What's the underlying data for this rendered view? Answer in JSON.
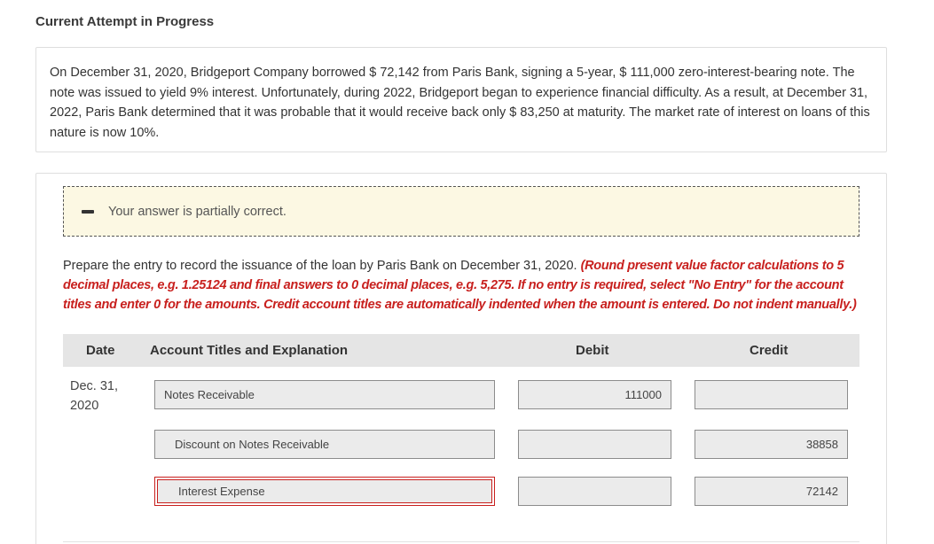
{
  "header": {
    "section_title": "Current Attempt in Progress"
  },
  "question": {
    "text": "On December 31, 2020, Bridgeport Company borrowed $ 72,142 from Paris Bank, signing a 5-year, $ 111,000 zero-interest-bearing note. The note was issued to yield 9% interest. Unfortunately, during 2022, Bridgeport began to experience financial difficulty. As a result, at December 31, 2022, Paris Bank determined that it was probable that it would receive back only $ 83,250 at maturity. The market rate of interest on loans of this nature is now 10%."
  },
  "feedback": {
    "text": "Your answer is partially correct."
  },
  "instructions": {
    "prompt": "Prepare the entry to record the issuance of the loan by Paris Bank on December 31, 2020.",
    "note": "(Round present value factor calculations to 5 decimal places, e.g. 1.25124 and final answers to 0 decimal places, e.g. 5,275. If no entry is required, select \"No Entry\" for the account titles and enter 0 for the amounts. Credit account titles are automatically indented when the amount is entered. Do not indent manually.)"
  },
  "table": {
    "headers": {
      "date": "Date",
      "account": "Account Titles and Explanation",
      "debit": "Debit",
      "credit": "Credit"
    },
    "date_line1": "Dec. 31,",
    "date_line2": "2020",
    "rows": [
      {
        "account": "Notes Receivable",
        "debit": "111000",
        "credit": ""
      },
      {
        "account": "Discount on Notes Receivable",
        "debit": "",
        "credit": "38858"
      },
      {
        "account": "Interest Expense",
        "debit": "",
        "credit": "72142"
      }
    ]
  },
  "colors": {
    "error_red": "#c8201e",
    "feedback_bg": "#fcf8e3",
    "header_bg": "#e5e5e5",
    "field_bg": "#ebebeb"
  }
}
